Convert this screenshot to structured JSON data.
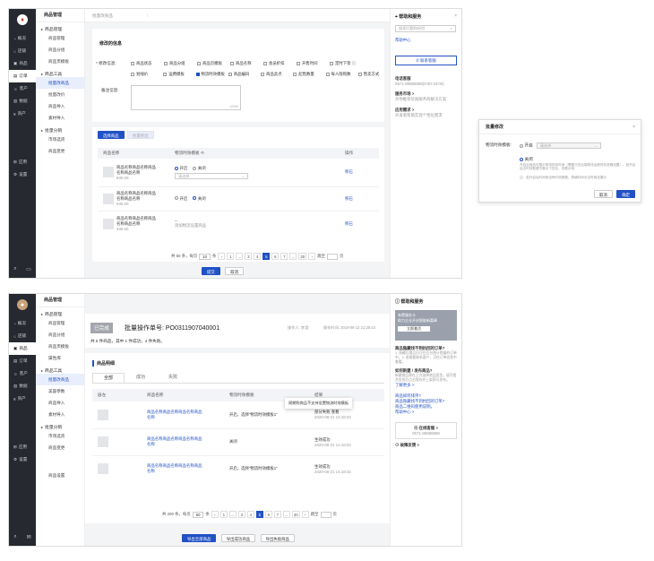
{
  "s1": {
    "rail": [
      "概况",
      "店铺",
      "商品",
      "订单",
      "客户",
      "数据",
      "资产",
      "应用",
      "设置"
    ],
    "sub_title": "商品管理",
    "sub_groups": [
      {
        "g": "商品管理",
        "items": [
          "商品管理",
          "商品分组",
          "商品页模板"
        ]
      },
      {
        "g": "商品工具",
        "items": [
          "批量改商品",
          "批量改价",
          "商品导入",
          "素材导入"
        ]
      },
      {
        "g": "批量分销",
        "items": [
          "市场选货",
          "商品变更"
        ]
      }
    ],
    "topbar": "批量改商品",
    "section_title": "修改的信息",
    "mod_label": "* 修改信息:",
    "mod_opts_row1": [
      "商品状态",
      "商品分组",
      "商品页模板",
      "商品名称",
      "会员折扣",
      "开售时间",
      "定时下架 ⓘ"
    ],
    "mod_opts_row2": [
      "划线价",
      "运费模板",
      "物流时效模板",
      "商品编码",
      "商品卖点",
      "起售数量",
      "每人限购数",
      "售卖方式"
    ],
    "remark_label": "备注信息:",
    "remark_count": "0/200",
    "btn_select": "选择商品",
    "btn_clear": "批量移出",
    "col_name": "商品名称",
    "col_logi": "物流时效模板 ⟲",
    "col_op": "操作",
    "rows": [
      {
        "name": "商品名称商品名称商品名称商品名称",
        "price": "¥30.00",
        "open": "开启",
        "close": "关闭",
        "ph": "请选择",
        "op": "移石"
      },
      {
        "name": "商品名称商品名称商品名称商品名称",
        "price": "¥30.00",
        "open": "开启",
        "close": "关闭",
        "op": "移石"
      },
      {
        "name": "商品名称商品名称商品名称商品名称",
        "price": "¥30.00",
        "dash": "--",
        "hint": "添加物流设置商品",
        "op": "移石"
      }
    ],
    "pager": {
      "total": "共 50 条，每页",
      "size": "10",
      "unit": "条",
      "pages": [
        "1",
        "...",
        "3",
        "4",
        "5",
        "6",
        "7",
        "...",
        "20"
      ],
      "active": "5",
      "jump": "跳至",
      "pageunit": "页"
    },
    "ok": "提交",
    "cancel": "取消",
    "help": {
      "title": "帮助和服务",
      "search": "搜索问题和经验",
      "center": "帮助中心",
      "contact": "✆ 联系客服",
      "phone_t": "电话客服",
      "phone": "0571-88888888(9:00-18:00)",
      "market_t": "服务市场 >",
      "market_d": "为你推荐优质服务商解决方案",
      "feedback_t": "应用需求 >",
      "feedback_d": "开发者帮助实现个性化需求"
    }
  },
  "modal": {
    "title": "批量修改",
    "label": "物流时效模板:",
    "open": "开启",
    "close": "关闭",
    "ph": "请选择",
    "desc": "开启后商品可展示物流时效时间（需要已在后端物流运费时效准确设置）。若开启后无时效数据不展示个性化，查看示例",
    "note": "注：若开启后时间段没有时效数据，表格时间为空时商品展示",
    "cancel": "取消",
    "ok": "确定"
  },
  "s2": {
    "rail": [
      "概况",
      "店铺",
      "商品",
      "订单",
      "客户",
      "数据",
      "资产",
      "应用",
      "设置"
    ],
    "sub_title": "商品管理",
    "sub_groups": [
      {
        "g": "商品管理",
        "items": [
          "商品管理",
          "商品分组",
          "商品页模板",
          "属性库"
        ]
      },
      {
        "g": "商品工具",
        "items": [
          "批量改商品",
          "美容参数",
          "商品导入",
          "素材导入"
        ]
      },
      {
        "g": "批量分销",
        "items": [
          "市场选货",
          "商品变更"
        ]
      },
      {
        "g": "",
        "items": [
          "商品设置"
        ]
      }
    ],
    "status": "已完成",
    "title": "批量操作单号: PO0311907040001",
    "operator": "操作人: 李澄",
    "optime": "操作时间: 2019-08-12 21:28:43",
    "summary": "共 5 件商品，其中 1 件成功，4 件失败。",
    "detail": "商品明细",
    "tabs": [
      "全部",
      "成功",
      "失败"
    ],
    "cols": [
      "层左",
      "商品名称",
      "物流时效模板",
      "结果"
    ],
    "tooltip": "周期购商品不支持设置物流时效模板",
    "rows": [
      {
        "name": "商品名称商品名称商品名称商品名称",
        "logi": "开启，选择“物流时效模板1”",
        "res": "部分失败 查看",
        "time": "2020-08-21 14:18:32"
      },
      {
        "name": "商品名称商品名称商品名称商品名称",
        "logi": "关闭",
        "res": "生效成功",
        "time": "2020-08-21 14:18:32"
      },
      {
        "name": "商品名称商品名称商品名称商品名称",
        "logi": "开启，选择“物流时效模板1”",
        "res": "生效成功",
        "time": "2020-08-21 14:18:32"
      }
    ],
    "pager": {
      "total": "共 200 条，每页",
      "size": "50",
      "unit": "条",
      "pages": [
        "1",
        "...",
        "3",
        "4",
        "5",
        "6",
        "7",
        "...",
        "20"
      ],
      "active": "5",
      "jump": "跳至",
      "pageunit": "页"
    },
    "btns": [
      "导出全部商品",
      "导出成功商品",
      "导出失败商品"
    ],
    "help": {
      "title": "帮助和服务",
      "banner1": "有赞服务卡",
      "banner2": "助力企业开启智能新篇章",
      "banner3": "立即激活",
      "q1": "商品隐藏找不到抗回的订单?",
      "q1d": "1. 隐藏后商品仍可在后台统计销量的订单中。2. 若需要联系客户，可在订单信息中查看。",
      "q2": "如何新建 / 发布商品?",
      "q2d": "新建商品需在上方选择商品类型，填写相关信息后点击保存并上架即可发布。",
      "more": "了解更多 >",
      "links": [
        "商品如何排序?",
        "商品隐藏找不到抗回的订单?",
        "商品二维码使用说明。"
      ],
      "center": "帮助中心 >",
      "online": "⦿ 在线客服 >",
      "phone": "0571-88888888",
      "fb": "⊙ 故障反馈 >"
    }
  }
}
